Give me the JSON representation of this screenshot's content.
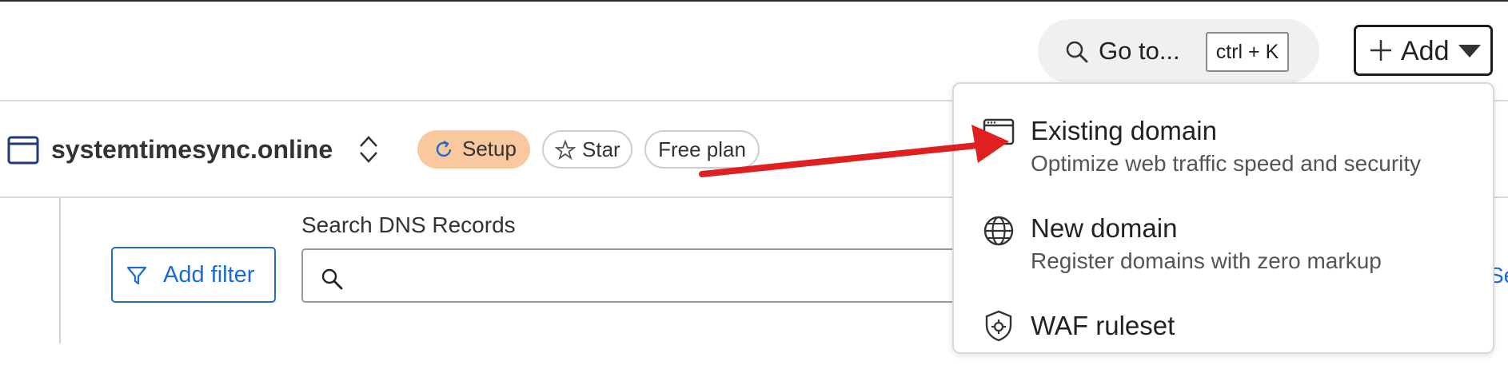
{
  "header": {
    "goto": {
      "label": "Go to...",
      "shortcut": "ctrl + K",
      "icon": "search-icon"
    },
    "add_button": {
      "label": "Add",
      "plus_icon": "plus-icon",
      "caret_icon": "caret-down-icon"
    }
  },
  "zone": {
    "icon": "browser-window-icon",
    "name": "systemtimesync.online",
    "switcher_icon": "chevron-up-down-icon",
    "badges": [
      {
        "label": "Setup",
        "icon": "refresh-icon",
        "color": "#f9c89e"
      },
      {
        "label": "Star",
        "icon": "star-icon"
      },
      {
        "label": "Free plan"
      }
    ]
  },
  "dns": {
    "filter_button": {
      "label": "Add filter",
      "icon": "filter-icon"
    },
    "search": {
      "label": "Search DNS Records",
      "value": "",
      "placeholder": ""
    },
    "edge_link_fragment": "Se"
  },
  "menu": {
    "items": [
      {
        "icon": "browser-window-icon",
        "title": "Existing domain",
        "description": "Optimize web traffic speed and security"
      },
      {
        "icon": "globe-icon",
        "title": "New domain",
        "description": "Register domains with zero markup"
      },
      {
        "icon": "shield-gear-icon",
        "title": "WAF ruleset",
        "description": ""
      }
    ]
  },
  "colors": {
    "accent": "#1a6bd6",
    "setup_badge": "#f9c89e",
    "annotation_arrow": "#e02020"
  }
}
